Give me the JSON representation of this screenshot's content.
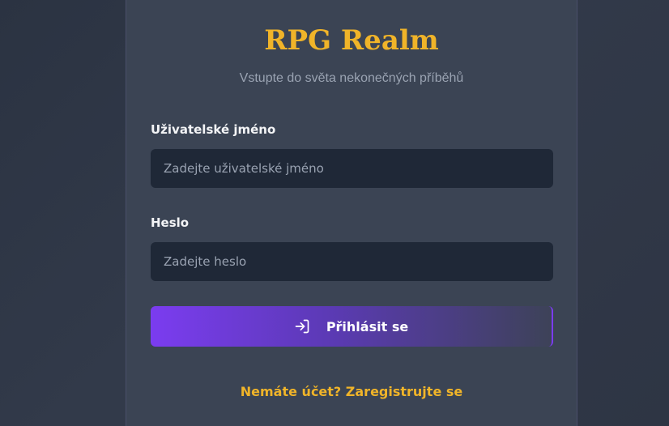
{
  "app": {
    "title": "RPG Realm",
    "subtitle": "Vstupte do světa nekonečných příběhů"
  },
  "form": {
    "username": {
      "label": "Uživatelské jméno",
      "placeholder": "Zadejte uživatelské jméno",
      "value": ""
    },
    "password": {
      "label": "Heslo",
      "placeholder": "Zadejte heslo",
      "value": ""
    },
    "submit": {
      "label": "Přihlásit se",
      "icon": "login-icon"
    }
  },
  "register": {
    "link_text": "Nemáte účet? Zaregistrujte se"
  },
  "colors": {
    "accent": "#f0b429",
    "button_start": "#7b3cf0",
    "input_bg": "#1f2837",
    "card_bg": "#3b4454"
  }
}
